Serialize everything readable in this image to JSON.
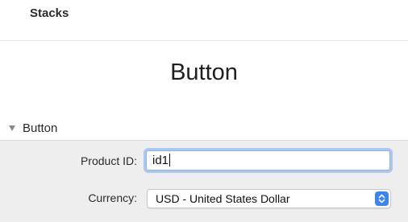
{
  "header": {
    "label": "Stacks"
  },
  "main": {
    "title": "Button"
  },
  "section": {
    "title": "Button",
    "expanded": true,
    "fields": {
      "product_id": {
        "label": "Product ID:",
        "value": "id1"
      },
      "currency": {
        "label": "Currency:",
        "selected": "USD - United States Dollar"
      }
    }
  },
  "icons": {
    "disclosure": "triangle-down-icon",
    "select_arrows": "chevron-up-down-icon"
  },
  "colors": {
    "focus_ring": "#a9c8f1",
    "stepper_accent": "#3a84f3",
    "panel_background": "#eeeeee"
  }
}
